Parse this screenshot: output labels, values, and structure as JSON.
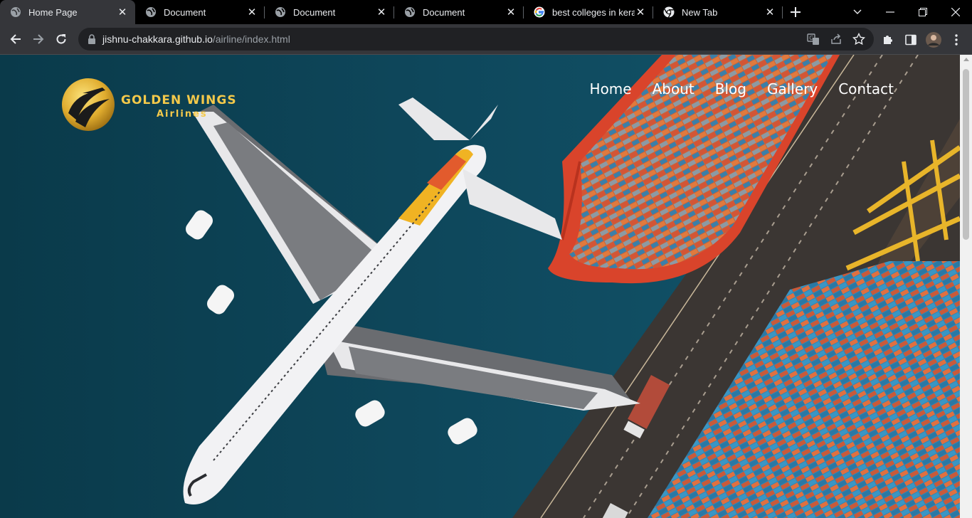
{
  "browser": {
    "tabs": [
      {
        "title": "Home Page",
        "icon": "globe-icon",
        "active": true
      },
      {
        "title": "Document",
        "icon": "globe-icon",
        "active": false
      },
      {
        "title": "Document",
        "icon": "globe-icon",
        "active": false
      },
      {
        "title": "Document",
        "icon": "globe-icon",
        "active": false
      },
      {
        "title": "best colleges in kerala",
        "icon": "google-icon",
        "active": false
      },
      {
        "title": "New Tab",
        "icon": "chrome-icon",
        "active": false
      }
    ],
    "address": {
      "host": "jishnu-chakkara.github.io",
      "path": "/airline/index.html"
    }
  },
  "site": {
    "logo": {
      "line1": "GOLDEN WINGS",
      "line2": "Airlines"
    },
    "nav": [
      {
        "label": "Home"
      },
      {
        "label": "About"
      },
      {
        "label": "Blog"
      },
      {
        "label": "Gallery"
      },
      {
        "label": "Contact"
      }
    ]
  },
  "colors": {
    "brand_gold": "#f4c94a",
    "sea": "#0d4257",
    "ship_red": "#d9442b"
  }
}
